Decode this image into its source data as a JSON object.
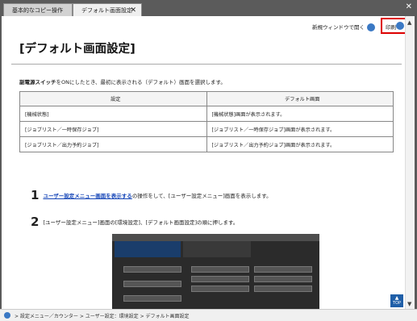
{
  "tabs": [
    {
      "label": "基本的なコピー操作"
    },
    {
      "label": "デフォルト画面設定",
      "close": "✕"
    }
  ],
  "window_close": "✕",
  "toolbar": {
    "new_window_label": "新規ウィンドウで開く",
    "print_label": "印刷"
  },
  "page": {
    "title": "[デフォルト画面設定]",
    "intro_bold": "副電源スイッチ",
    "intro_rest": "をONにしたとき、最初に表示される（デフォルト）画面を選択します。"
  },
  "table": {
    "headers": [
      "設定",
      "デフォルト画面"
    ],
    "rows": [
      [
        "[機械状態]",
        "[機械状態]画面が表示されます。"
      ],
      [
        "[ジョブリスト／一時保存ジョブ]",
        "[ジョブリスト／一時保存ジョブ]画面が表示されます。"
      ],
      [
        "[ジョブリスト／出力予約ジョブ]",
        "[ジョブリスト／出力予約ジョブ]画面が表示されます。"
      ]
    ]
  },
  "steps": [
    {
      "num": "1",
      "link": "ユーザー設定メニュー画面を表示する",
      "text": "の操作をして、[ユーザー設定メニュー]画面を表示します。"
    },
    {
      "num": "2",
      "text": "[ユーザー設定メニュー]画面の[環境設定]、[デフォルト画面設定]の順に押します。"
    }
  ],
  "top_button": "TOP",
  "breadcrumb": "> 設定メニュー／カウンター > ユーザー設定：環境設定 > デフォルト画面設定"
}
